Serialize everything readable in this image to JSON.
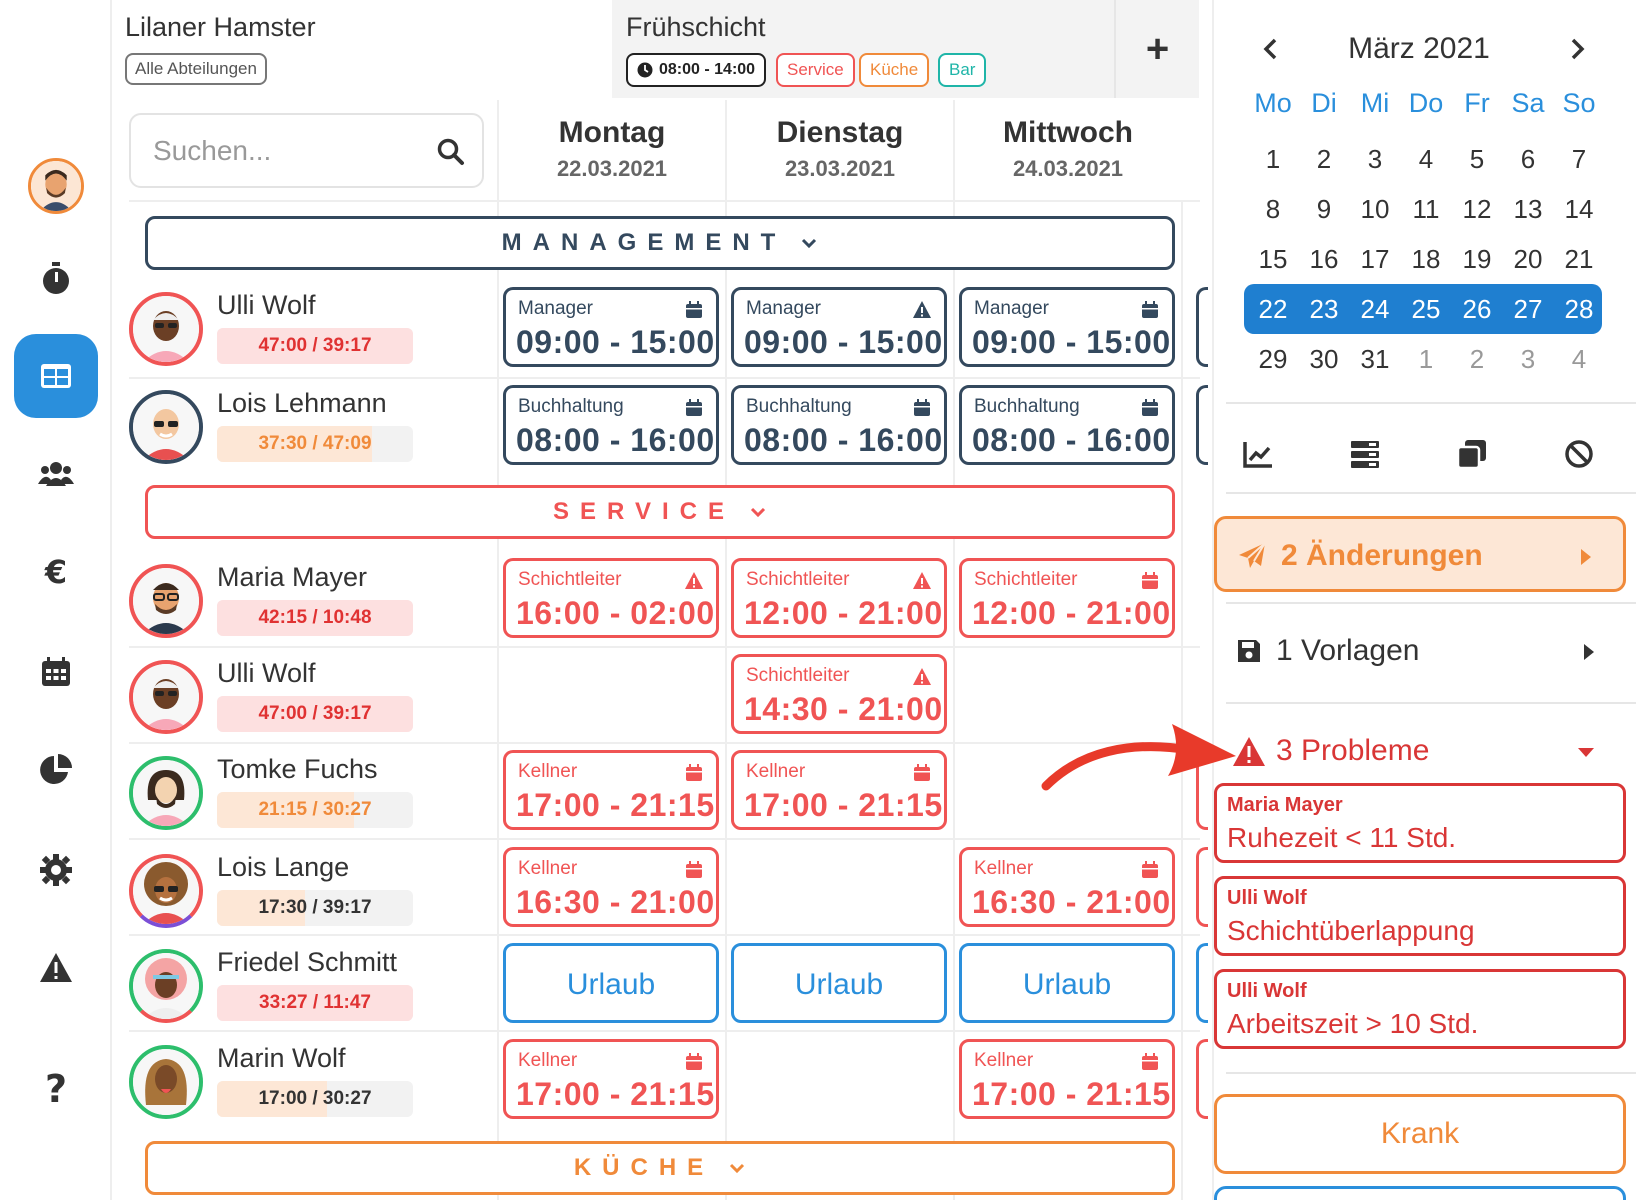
{
  "header": {
    "company": "Lilaner Hamster",
    "department_filter": "Alle Abteilungen",
    "shift_name": "Frühschicht",
    "shift_time": "08:00 - 14:00",
    "tags": [
      "Service",
      "Küche",
      "Bar"
    ],
    "add_label": "+"
  },
  "search": {
    "placeholder": "Suchen..."
  },
  "days": [
    {
      "name": "Montag",
      "date": "22.03.2021"
    },
    {
      "name": "Dienstag",
      "date": "23.03.2021"
    },
    {
      "name": "Mittwoch",
      "date": "24.03.2021"
    }
  ],
  "departments": {
    "management": "MANAGEMENT",
    "service": "SERVICE",
    "kueche": "KÜCHE"
  },
  "employees": [
    {
      "name": "Ulli Wolf",
      "hours": "47:00 / 39:17",
      "progress": 1.0
    },
    {
      "name": "Lois Lehmann",
      "hours": "37:30 / 47:09",
      "progress": 0.79
    },
    {
      "name": "Maria Mayer",
      "hours": "42:15 / 10:48",
      "progress": 1.0
    },
    {
      "name": "Ulli Wolf",
      "hours": "47:00 / 39:17",
      "progress": 1.0
    },
    {
      "name": "Tomke Fuchs",
      "hours": "21:15 / 30:27",
      "progress": 0.7
    },
    {
      "name": "Lois Lange",
      "hours": "17:30 / 39:17",
      "progress": 0.45
    },
    {
      "name": "Friedel Schmitt",
      "hours": "33:27 / 11:47",
      "progress": 1.0
    },
    {
      "name": "Marin Wolf",
      "hours": "17:00 / 30:27",
      "progress": 0.56
    }
  ],
  "shifts": {
    "r0": [
      {
        "role": "Manager",
        "time": "09:00 - 15:00",
        "icon": "calendar-icon"
      },
      {
        "role": "Manager",
        "time": "09:00 - 15:00",
        "icon": "warning-icon"
      },
      {
        "role": "Manager",
        "time": "09:00 - 15:00",
        "icon": "calendar-icon"
      }
    ],
    "r1": [
      {
        "role": "Buchhaltung",
        "time": "08:00 - 16:00",
        "icon": "calendar-icon"
      },
      {
        "role": "Buchhaltung",
        "time": "08:00 - 16:00",
        "icon": "calendar-icon"
      },
      {
        "role": "Buchhaltung",
        "time": "08:00 - 16:00",
        "icon": "calendar-icon"
      }
    ],
    "r2": [
      {
        "role": "Schichtleiter",
        "time": "16:00 - 02:00",
        "icon": "warning-icon"
      },
      {
        "role": "Schichtleiter",
        "time": "12:00 - 21:00",
        "icon": "warning-icon"
      },
      {
        "role": "Schichtleiter",
        "time": "12:00 - 21:00",
        "icon": "calendar-icon"
      }
    ],
    "r3": [
      {
        "role": "Schichtleiter",
        "time": "14:30 - 21:00",
        "icon": "warning-icon"
      }
    ],
    "r4": [
      {
        "role": "Kellner",
        "time": "17:00 - 21:15",
        "icon": "calendar-icon"
      },
      {
        "role": "Kellner",
        "time": "17:00 - 21:15",
        "icon": "calendar-icon"
      }
    ],
    "r5": [
      {
        "role": "Kellner",
        "time": "16:30 - 21:00",
        "icon": "calendar-icon"
      },
      {
        "role": "Kellner",
        "time": "16:30 - 21:00",
        "icon": "calendar-icon"
      }
    ],
    "r6": [
      "Urlaub",
      "Urlaub",
      "Urlaub"
    ],
    "r7": [
      {
        "role": "Kellner",
        "time": "17:00 - 21:15",
        "icon": "calendar-icon"
      },
      {
        "role": "Kellner",
        "time": "17:00 - 21:15",
        "icon": "calendar-icon"
      }
    ]
  },
  "calendar": {
    "title": "März 2021",
    "weekdays": [
      "Mo",
      "Di",
      "Mi",
      "Do",
      "Fr",
      "Sa",
      "So"
    ],
    "weeks": [
      [
        "1",
        "2",
        "3",
        "4",
        "5",
        "6",
        "7"
      ],
      [
        "8",
        "9",
        "10",
        "11",
        "12",
        "13",
        "14"
      ],
      [
        "15",
        "16",
        "17",
        "18",
        "19",
        "20",
        "21"
      ],
      [
        "22",
        "23",
        "24",
        "25",
        "26",
        "27",
        "28"
      ],
      [
        "29",
        "30",
        "31",
        "1",
        "2",
        "3",
        "4"
      ]
    ],
    "selected_week": 3
  },
  "panel": {
    "changes": "2 Änderungen",
    "templates": "1 Vorlagen",
    "problems": "3 Probleme",
    "problem_list": [
      {
        "who": "Maria Mayer",
        "what": "Ruhezeit < 11 Std."
      },
      {
        "who": "Ulli Wolf",
        "what": "Schichtüberlappung"
      },
      {
        "who": "Ulli Wolf",
        "what": "Arbeitszeit > 10 Std."
      }
    ],
    "sick": "Krank"
  },
  "colors": {
    "primary": "#2a8fdc",
    "management": "#34495e",
    "service": "#f05454",
    "kueche": "#f08a3a",
    "bar": "#1fb5a8",
    "problem": "#d93636"
  }
}
